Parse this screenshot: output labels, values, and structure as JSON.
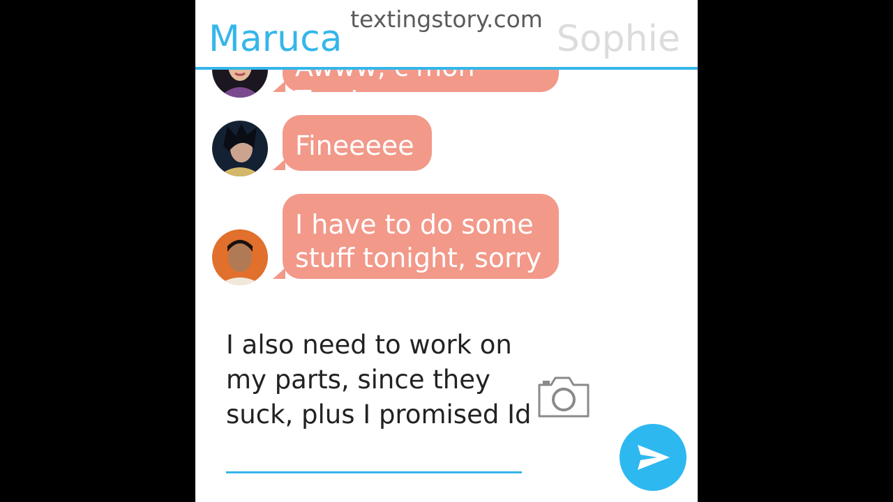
{
  "header": {
    "left_contact": "Maruca",
    "right_contact": "Sophie",
    "watermark": "textingstory.com"
  },
  "messages": [
    {
      "text": "Awww, c'mon Tam!",
      "avatar": "woman-dark-hair-avatar"
    },
    {
      "text": "Fineeeee",
      "avatar": "man-spiky-hair-avatar"
    },
    {
      "text": "I have to do some stuff tonight, sorry",
      "avatar": "man-short-hair-avatar"
    }
  ],
  "composer": {
    "draft_text": "I also need to work on my parts, since they suck, plus I promised Id"
  },
  "icons": {
    "camera": "camera-icon",
    "send": "send-icon"
  },
  "colors": {
    "accent": "#35b6ea",
    "bubble": "#f2998a",
    "send_button": "#2eb8f0"
  }
}
